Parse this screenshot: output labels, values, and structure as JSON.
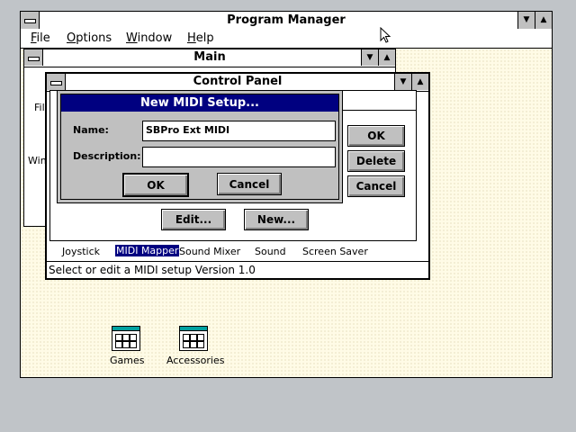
{
  "program_manager": {
    "title": "Program Manager",
    "menu": [
      "File",
      "Options",
      "Window",
      "Help"
    ],
    "min_glyph": "▼",
    "max_glyph": "▲"
  },
  "main_group": {
    "title": "Main",
    "partial_labels": [
      "File",
      "Win"
    ]
  },
  "control_panel": {
    "title": "Control Panel",
    "icons": [
      "Joystick",
      "MIDI Mapper",
      "Sound Mixer",
      "Sound",
      "Screen Saver"
    ],
    "status": "Select or edit a MIDI setup Version 1.0"
  },
  "midi_mapper": {
    "buttons": {
      "ok": "OK",
      "delete": "Delete",
      "cancel": "Cancel",
      "edit": "Edit...",
      "new": "New..."
    }
  },
  "dialog": {
    "title": "New MIDI Setup...",
    "name_label": "Name:",
    "name_value": "SBPro Ext MIDI",
    "description_label": "Description:",
    "description_value": "",
    "ok": "OK",
    "cancel": "Cancel"
  },
  "groups": [
    {
      "label": "Games"
    },
    {
      "label": "Accessories"
    }
  ],
  "colors": {
    "dialog_title_bg": "#000080",
    "selection_bg": "#000080",
    "group_icon_bar": "#00a0a0"
  }
}
